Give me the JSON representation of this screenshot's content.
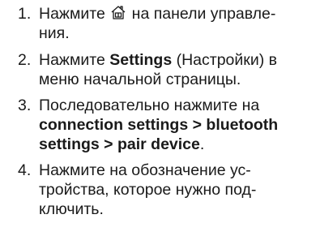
{
  "steps": [
    {
      "number": "1.",
      "lines": [
        {
          "a": "Нажмите",
          "b": "на панели управле-"
        },
        {
          "text": "ния."
        }
      ]
    },
    {
      "number": "2.",
      "lines": [
        {
          "a": "Нажмите ",
          "bold": "Settings",
          "b": " (Настройки) в"
        },
        {
          "text": "меню начальной страницы."
        }
      ]
    },
    {
      "number": "3.",
      "lines": [
        {
          "text": "Последовательно нажмите на"
        },
        {
          "bold": "connection settings > bluetooth"
        },
        {
          "bold": "settings > pair device",
          "b": "."
        }
      ]
    },
    {
      "number": "4.",
      "lines": [
        {
          "text": "Нажмите на обозначение ус-"
        },
        {
          "text": "тройства, которое нужно под-"
        },
        {
          "text": "ключить."
        }
      ]
    }
  ],
  "icons": {
    "step1_icon": "home-icon"
  }
}
